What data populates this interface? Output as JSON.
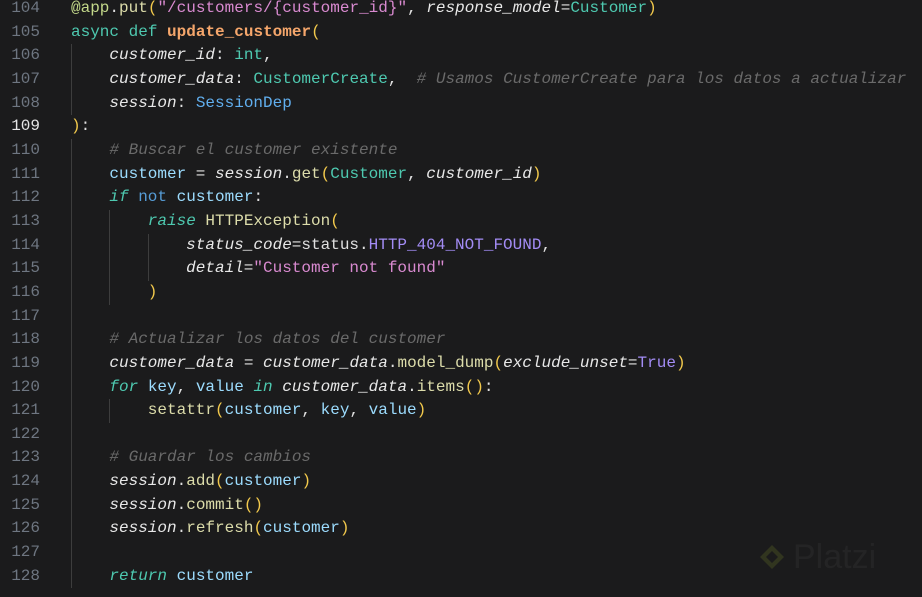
{
  "editor": {
    "active_line": 109,
    "lines": [
      {
        "n": "104",
        "g": [],
        "t": [
          [
            "@app",
            "dec"
          ],
          [
            ".",
            "pl"
          ],
          [
            "put",
            "m"
          ],
          [
            "(",
            "br"
          ],
          [
            "\"/customers/{customer_id}\"",
            "s"
          ],
          [
            ", ",
            "pl"
          ],
          [
            "response_model",
            "p"
          ],
          [
            "=",
            "pl"
          ],
          [
            "Customer",
            "ty"
          ],
          [
            ")",
            "br"
          ]
        ]
      },
      {
        "n": "105",
        "g": [],
        "t": [
          [
            "async",
            "kw"
          ],
          [
            " ",
            "pl"
          ],
          [
            "def",
            "kw"
          ],
          [
            " ",
            "pl"
          ],
          [
            "update_customer",
            "fn"
          ],
          [
            "(",
            "br"
          ]
        ]
      },
      {
        "n": "106",
        "g": [
          1
        ],
        "t": [
          [
            "customer_id",
            "p"
          ],
          [
            ": ",
            "pl"
          ],
          [
            "int",
            "ty"
          ],
          [
            ",",
            "pl"
          ]
        ]
      },
      {
        "n": "107",
        "g": [
          1
        ],
        "t": [
          [
            "customer_data",
            "p"
          ],
          [
            ": ",
            "pl"
          ],
          [
            "CustomerCreate",
            "ty"
          ],
          [
            ",  ",
            "pl"
          ],
          [
            "# Usamos CustomerCreate para los datos a actualizar",
            "c"
          ]
        ]
      },
      {
        "n": "108",
        "g": [
          1
        ],
        "t": [
          [
            "session",
            "p"
          ],
          [
            ": ",
            "pl"
          ],
          [
            "SessionDep",
            "cl"
          ]
        ]
      },
      {
        "n": "109",
        "g": [],
        "t": [
          [
            ")",
            "br"
          ],
          [
            ":",
            "pl"
          ]
        ]
      },
      {
        "n": "110",
        "g": [
          1
        ],
        "t": [
          [
            "# Buscar el customer existente",
            "c"
          ]
        ]
      },
      {
        "n": "111",
        "g": [
          1
        ],
        "t": [
          [
            "customer",
            "v"
          ],
          [
            " = ",
            "pl"
          ],
          [
            "session",
            "vi"
          ],
          [
            ".",
            "pl"
          ],
          [
            "get",
            "m"
          ],
          [
            "(",
            "br"
          ],
          [
            "Customer",
            "ty"
          ],
          [
            ", ",
            "pl"
          ],
          [
            "customer_id",
            "vi"
          ],
          [
            ")",
            "br"
          ]
        ]
      },
      {
        "n": "112",
        "g": [
          1
        ],
        "t": [
          [
            "if",
            "ctl"
          ],
          [
            " ",
            "pl"
          ],
          [
            "not",
            "not"
          ],
          [
            " ",
            "pl"
          ],
          [
            "customer",
            "v"
          ],
          [
            ":",
            "pl"
          ]
        ]
      },
      {
        "n": "113",
        "g": [
          1,
          1
        ],
        "t": [
          [
            "raise",
            "ctl"
          ],
          [
            " ",
            "pl"
          ],
          [
            "HTTPException",
            "m"
          ],
          [
            "(",
            "br"
          ]
        ]
      },
      {
        "n": "114",
        "g": [
          1,
          1,
          1
        ],
        "t": [
          [
            "status_code",
            "p"
          ],
          [
            "=",
            "pl"
          ],
          [
            "status",
            "pl"
          ],
          [
            ".",
            "pl"
          ],
          [
            "HTTP_404_NOT_FOUND",
            "k"
          ],
          [
            ",",
            "pl"
          ]
        ]
      },
      {
        "n": "115",
        "g": [
          1,
          1,
          1
        ],
        "t": [
          [
            "detail",
            "p"
          ],
          [
            "=",
            "pl"
          ],
          [
            "\"Customer not found\"",
            "s"
          ]
        ]
      },
      {
        "n": "116",
        "g": [
          1,
          1
        ],
        "t": [
          [
            ")",
            "br"
          ]
        ]
      },
      {
        "n": "117",
        "g": [
          1
        ],
        "t": []
      },
      {
        "n": "118",
        "g": [
          1
        ],
        "t": [
          [
            "# Actualizar los datos del customer",
            "c"
          ]
        ]
      },
      {
        "n": "119",
        "g": [
          1
        ],
        "t": [
          [
            "customer_data",
            "vi"
          ],
          [
            " = ",
            "pl"
          ],
          [
            "customer_data",
            "vi"
          ],
          [
            ".",
            "pl"
          ],
          [
            "model_dump",
            "m"
          ],
          [
            "(",
            "br"
          ],
          [
            "exclude_unset",
            "p"
          ],
          [
            "=",
            "pl"
          ],
          [
            "True",
            "k"
          ],
          [
            ")",
            "br"
          ]
        ]
      },
      {
        "n": "120",
        "g": [
          1
        ],
        "t": [
          [
            "for",
            "ctl"
          ],
          [
            " ",
            "pl"
          ],
          [
            "key",
            "v"
          ],
          [
            ", ",
            "pl"
          ],
          [
            "value",
            "v"
          ],
          [
            " ",
            "pl"
          ],
          [
            "in",
            "ctl"
          ],
          [
            " ",
            "pl"
          ],
          [
            "customer_data",
            "vi"
          ],
          [
            ".",
            "pl"
          ],
          [
            "items",
            "m"
          ],
          [
            "()",
            "br"
          ],
          [
            ":",
            "pl"
          ]
        ]
      },
      {
        "n": "121",
        "g": [
          1,
          1
        ],
        "t": [
          [
            "setattr",
            "m"
          ],
          [
            "(",
            "br"
          ],
          [
            "customer",
            "v"
          ],
          [
            ", ",
            "pl"
          ],
          [
            "key",
            "v"
          ],
          [
            ", ",
            "pl"
          ],
          [
            "value",
            "v"
          ],
          [
            ")",
            "br"
          ]
        ]
      },
      {
        "n": "122",
        "g": [
          1
        ],
        "t": []
      },
      {
        "n": "123",
        "g": [
          1
        ],
        "t": [
          [
            "# Guardar los cambios",
            "c"
          ]
        ]
      },
      {
        "n": "124",
        "g": [
          1
        ],
        "t": [
          [
            "session",
            "vi"
          ],
          [
            ".",
            "pl"
          ],
          [
            "add",
            "m"
          ],
          [
            "(",
            "br"
          ],
          [
            "customer",
            "v"
          ],
          [
            ")",
            "br"
          ]
        ]
      },
      {
        "n": "125",
        "g": [
          1
        ],
        "t": [
          [
            "session",
            "vi"
          ],
          [
            ".",
            "pl"
          ],
          [
            "commit",
            "m"
          ],
          [
            "()",
            "br"
          ]
        ]
      },
      {
        "n": "126",
        "g": [
          1
        ],
        "t": [
          [
            "session",
            "vi"
          ],
          [
            ".",
            "pl"
          ],
          [
            "refresh",
            "m"
          ],
          [
            "(",
            "br"
          ],
          [
            "customer",
            "v"
          ],
          [
            ")",
            "br"
          ]
        ]
      },
      {
        "n": "127",
        "g": [
          1
        ],
        "t": []
      },
      {
        "n": "128",
        "g": [
          1
        ],
        "t": [
          [
            "return",
            "ctl"
          ],
          [
            " ",
            "pl"
          ],
          [
            "customer",
            "v"
          ]
        ]
      }
    ]
  },
  "watermark": {
    "text": "Platzi",
    "color": "#3a3f22"
  }
}
